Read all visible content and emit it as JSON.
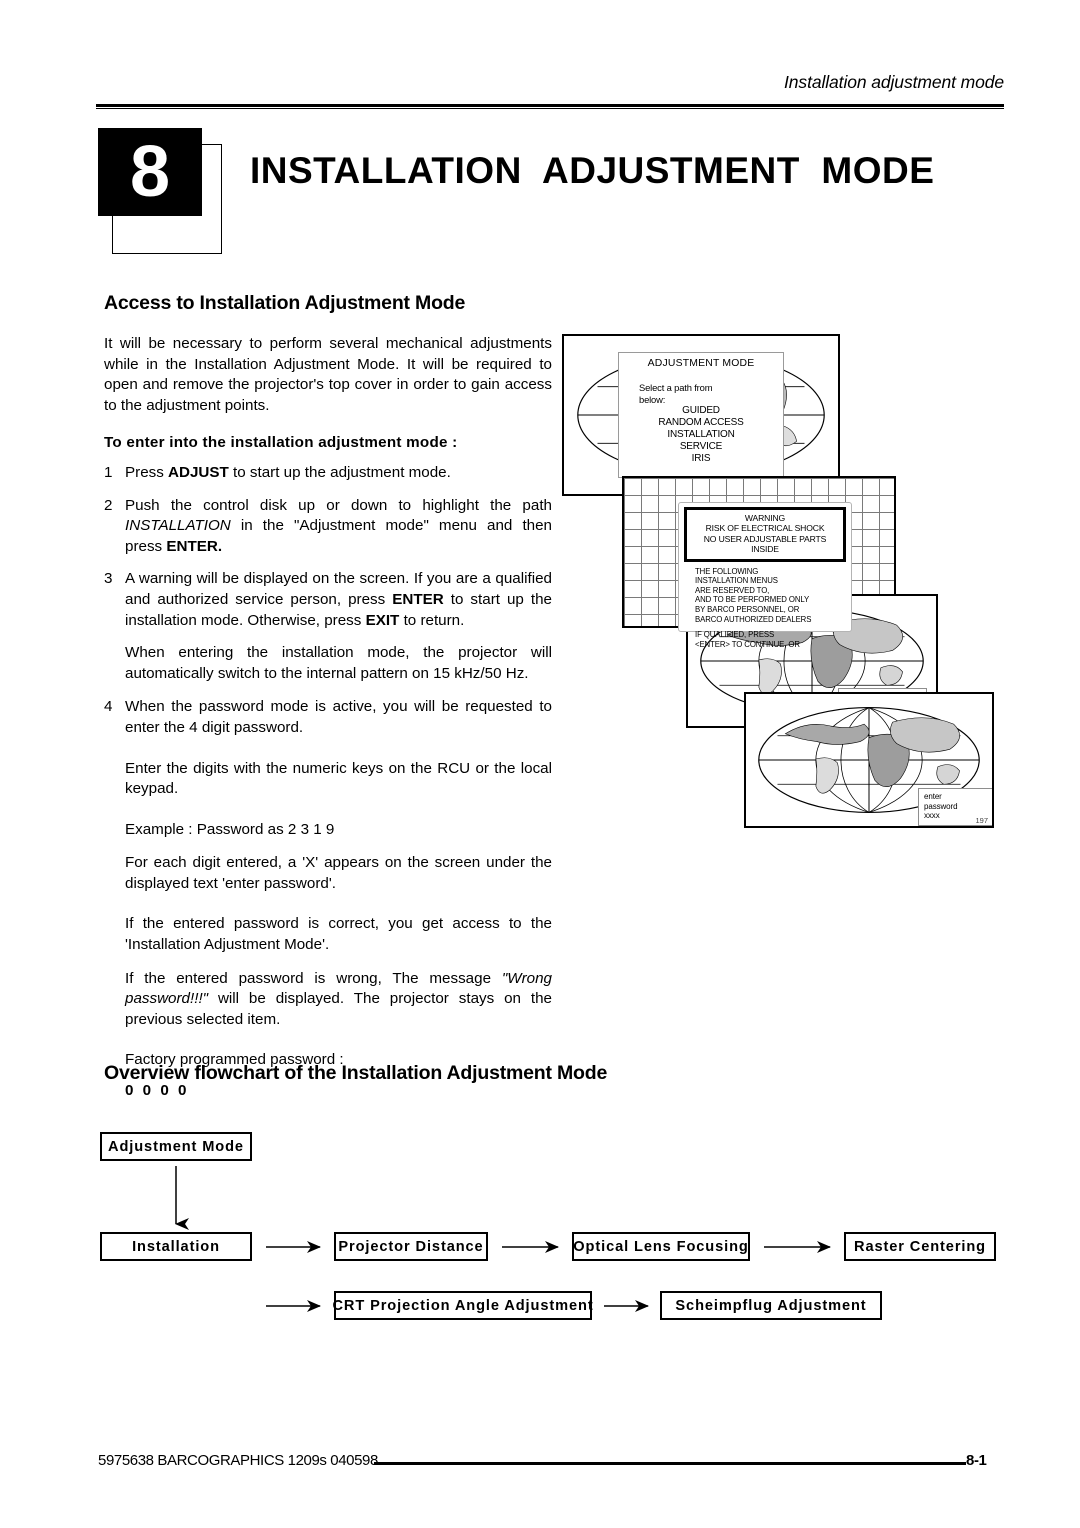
{
  "header": {
    "running_title": "Installation adjustment mode"
  },
  "chapter": {
    "number": "8",
    "title": "INSTALLATION  ADJUSTMENT  MODE"
  },
  "sections": {
    "access_heading": "Access to Installation Adjustment Mode",
    "flowchart_heading": "Overview flowchart of the Installation Adjustment Mode"
  },
  "body": {
    "intro": "It will be necessary to perform several mechanical adjustments while in the Installation Adjustment Mode. It will be required to open and remove the projector's top cover in order to gain access to the adjustment points.",
    "subhead": "To enter into the installation adjustment mode :",
    "steps": [
      {
        "num": "1",
        "parts": [
          {
            "t": "Press ",
            "s": "normal"
          },
          {
            "t": "ADJUST",
            "s": "bold"
          },
          {
            "t": " to start up the adjustment mode.",
            "s": "normal"
          }
        ]
      },
      {
        "num": "2",
        "parts": [
          {
            "t": "Push the control disk up or down to highlight the path ",
            "s": "normal"
          },
          {
            "t": "INSTALLATION",
            "s": "italic"
          },
          {
            "t": " in the \"Adjustment mode\" menu and then press ",
            "s": "normal"
          },
          {
            "t": "ENTER.",
            "s": "bold"
          }
        ]
      },
      {
        "num": "3",
        "parts": [
          {
            "t": "A warning will be displayed on the screen. If you are a qualified and authorized service person, press ",
            "s": "normal"
          },
          {
            "t": "ENTER",
            "s": "bold"
          },
          {
            "t": " to start up the installation mode. Otherwise, press ",
            "s": "normal"
          },
          {
            "t": "EXIT",
            "s": "bold"
          },
          {
            "t": " to return.",
            "s": "normal"
          }
        ]
      },
      {
        "num": "4",
        "parts": [
          {
            "t": "When the password mode is active, you will be requested to enter the 4 digit password.",
            "s": "normal"
          }
        ]
      }
    ],
    "note_after_step3": "When entering the installation mode, the projector will automatically switch to the internal pattern on 15 kHz/50 Hz.",
    "para_enter_digits": "Enter the digits with the numeric keys on the RCU or the local keypad.",
    "para_example": "Example : Password as 2 3 1 9",
    "para_each_digit": "For each digit entered, a 'X' appears on the screen under the displayed text 'enter password'.",
    "para_correct": "If the entered password is correct, you get access to the 'Installation Adjustment Mode'.",
    "para_wrong_pre": "If the entered password is wrong, The message ",
    "para_wrong_em": "\"Wrong password!!!\"",
    "para_wrong_post": " will be displayed. The projector stays on the previous selected item.",
    "para_factory": "Factory programmed  password :",
    "factory_password": "0 0 0 0"
  },
  "illustration": {
    "menu": {
      "title": "ADJUSTMENT MODE",
      "prompt_line1": "Select a path from",
      "prompt_line2": "below:",
      "options": [
        {
          "label": "GUIDED",
          "selected": false
        },
        {
          "label": "RANDOM ACCESS",
          "selected": false
        },
        {
          "label": "INSTALLATION",
          "selected": true
        },
        {
          "label": "SERVICE",
          "selected": false
        },
        {
          "label": "IRIS",
          "selected": false
        }
      ]
    },
    "warning": {
      "box_lines": [
        "WARNING",
        "RISK OF ELECTRICAL SHOCK",
        "NO USER ADJUSTABLE PARTS",
        "INSIDE"
      ],
      "body_lines": [
        "THE FOLLOWING",
        "INSTALLATION MENUS",
        "ARE RESERVED TO,",
        "AND TO BE PERFORMED ONLY",
        "BY BARCO PERSONNEL, OR",
        "BARCO AUTHORIZED DEALERS"
      ],
      "body_lines_2": [
        "IF QUALIFIED, PRESS",
        "<ENTER> TO CONTINUE, OR"
      ]
    },
    "password_prompt": {
      "line1": "enter",
      "line2": "password",
      "line3": "xxxx"
    },
    "figure_number": "197"
  },
  "flowchart": {
    "boxes": {
      "adjustment_mode": "Adjustment  Mode",
      "installation": "Installation",
      "projector_distance": "Projector  Distance",
      "optical_lens_focusing": "Optical  Lens  Focusing",
      "raster_centering": "Raster  Centering",
      "crt_projection_angle": "CRT  Projection  Angle  Adjustment",
      "scheimpflug": "Scheimpflug  Adjustment"
    }
  },
  "footer": {
    "doc_ref": "5975638 BARCOGRAPHICS 1209s 040598",
    "page_number": "8-1"
  }
}
